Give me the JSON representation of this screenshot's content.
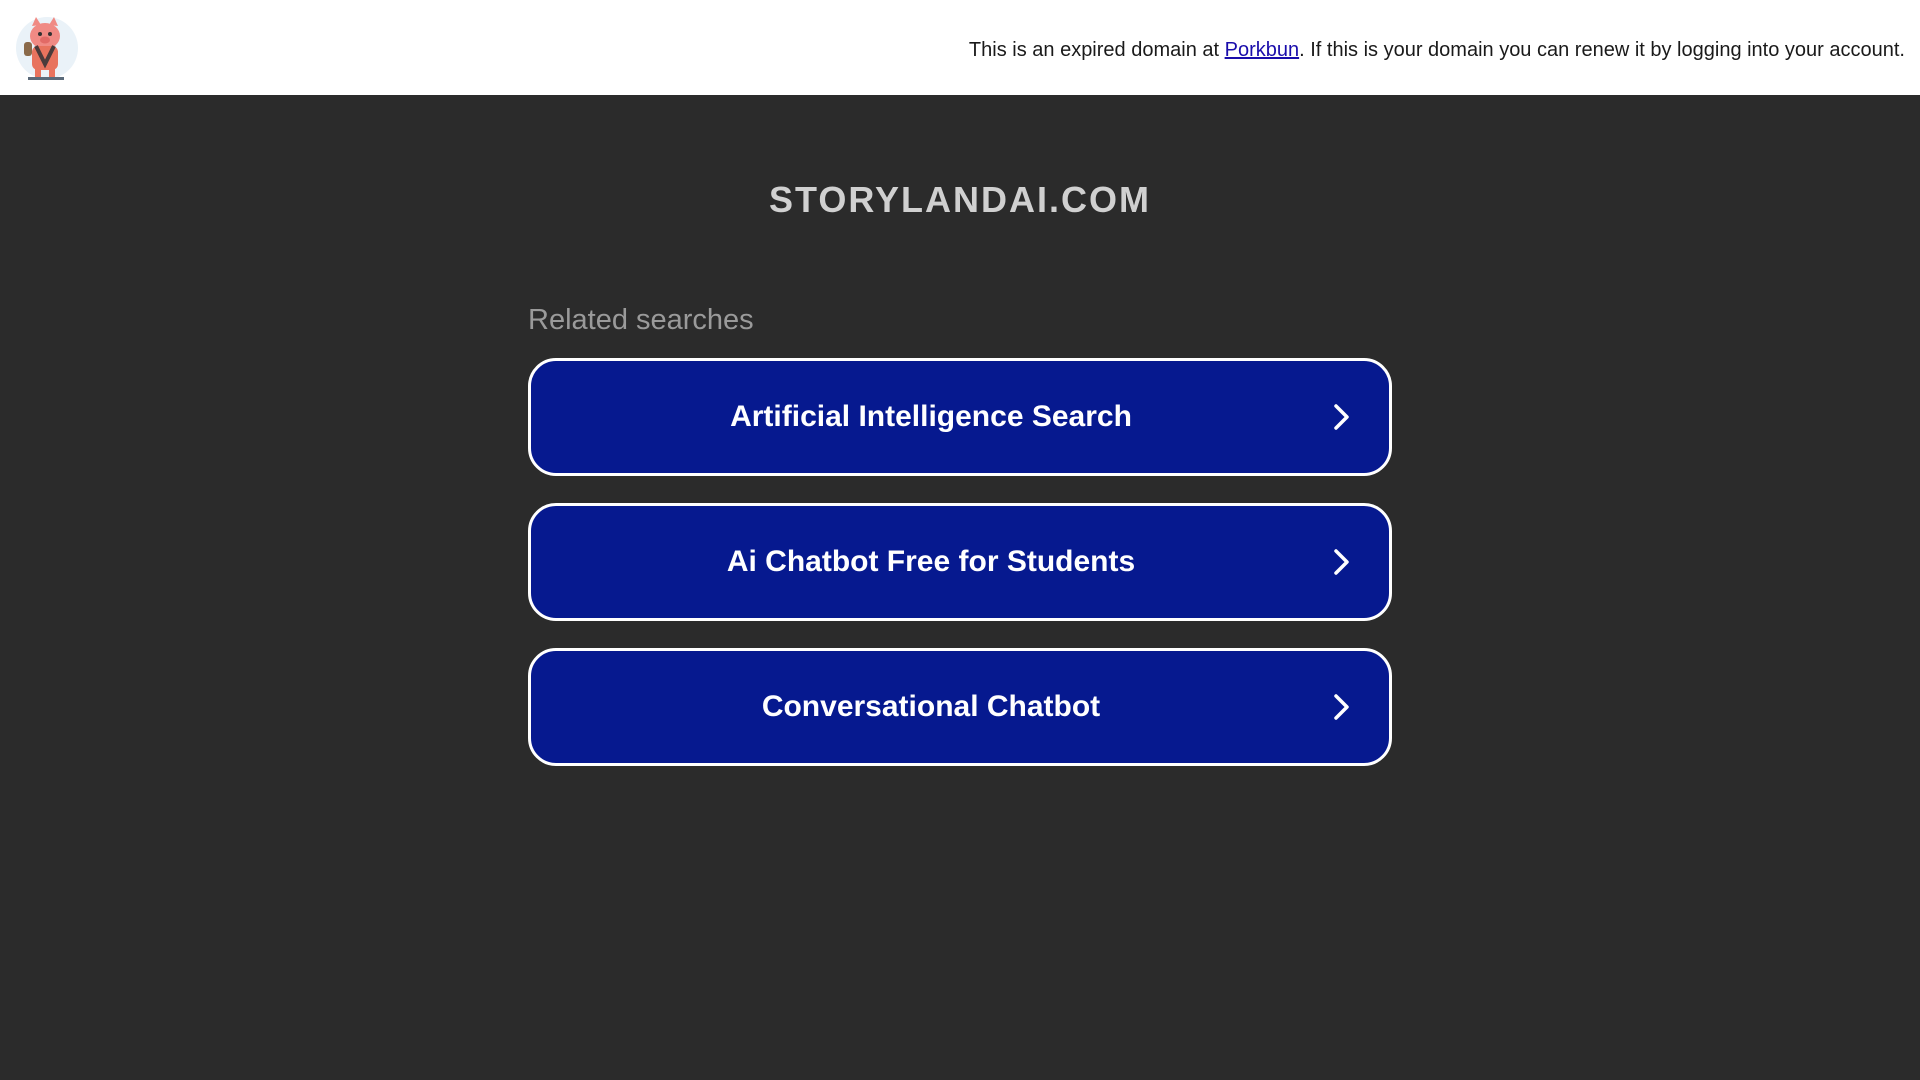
{
  "topbar": {
    "logo_icon": "pig-mascot-icon",
    "notice_before": "This is an expired domain at ",
    "notice_link": "Porkbun",
    "notice_after": ". If this is your domain you can renew it by logging into your account."
  },
  "main": {
    "domain": "STORYLANDAI.COM",
    "related_heading": "Related searches",
    "results": [
      {
        "label": "Artificial Intelligence Search",
        "icon": "chevron-right-icon"
      },
      {
        "label": "Ai Chatbot Free for Students",
        "icon": "chevron-right-icon"
      },
      {
        "label": "Conversational Chatbot",
        "icon": "chevron-right-icon"
      }
    ]
  },
  "colors": {
    "background": "#2b2b2b",
    "button": "#06198f",
    "button_border": "#ffffff",
    "link": "#1a0dab"
  }
}
